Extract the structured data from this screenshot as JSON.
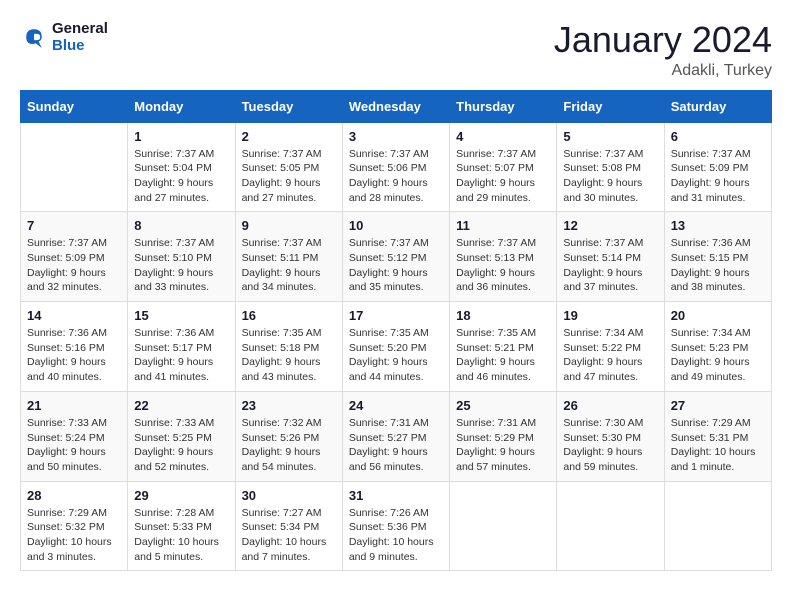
{
  "header": {
    "logo_line1": "General",
    "logo_line2": "Blue",
    "month_year": "January 2024",
    "location": "Adakli, Turkey"
  },
  "weekdays": [
    "Sunday",
    "Monday",
    "Tuesday",
    "Wednesday",
    "Thursday",
    "Friday",
    "Saturday"
  ],
  "weeks": [
    [
      {
        "day": "",
        "sunrise": "",
        "sunset": "",
        "daylight": ""
      },
      {
        "day": "1",
        "sunrise": "Sunrise: 7:37 AM",
        "sunset": "Sunset: 5:04 PM",
        "daylight": "Daylight: 9 hours and 27 minutes."
      },
      {
        "day": "2",
        "sunrise": "Sunrise: 7:37 AM",
        "sunset": "Sunset: 5:05 PM",
        "daylight": "Daylight: 9 hours and 27 minutes."
      },
      {
        "day": "3",
        "sunrise": "Sunrise: 7:37 AM",
        "sunset": "Sunset: 5:06 PM",
        "daylight": "Daylight: 9 hours and 28 minutes."
      },
      {
        "day": "4",
        "sunrise": "Sunrise: 7:37 AM",
        "sunset": "Sunset: 5:07 PM",
        "daylight": "Daylight: 9 hours and 29 minutes."
      },
      {
        "day": "5",
        "sunrise": "Sunrise: 7:37 AM",
        "sunset": "Sunset: 5:08 PM",
        "daylight": "Daylight: 9 hours and 30 minutes."
      },
      {
        "day": "6",
        "sunrise": "Sunrise: 7:37 AM",
        "sunset": "Sunset: 5:09 PM",
        "daylight": "Daylight: 9 hours and 31 minutes."
      }
    ],
    [
      {
        "day": "7",
        "sunrise": "Sunrise: 7:37 AM",
        "sunset": "Sunset: 5:09 PM",
        "daylight": "Daylight: 9 hours and 32 minutes."
      },
      {
        "day": "8",
        "sunrise": "Sunrise: 7:37 AM",
        "sunset": "Sunset: 5:10 PM",
        "daylight": "Daylight: 9 hours and 33 minutes."
      },
      {
        "day": "9",
        "sunrise": "Sunrise: 7:37 AM",
        "sunset": "Sunset: 5:11 PM",
        "daylight": "Daylight: 9 hours and 34 minutes."
      },
      {
        "day": "10",
        "sunrise": "Sunrise: 7:37 AM",
        "sunset": "Sunset: 5:12 PM",
        "daylight": "Daylight: 9 hours and 35 minutes."
      },
      {
        "day": "11",
        "sunrise": "Sunrise: 7:37 AM",
        "sunset": "Sunset: 5:13 PM",
        "daylight": "Daylight: 9 hours and 36 minutes."
      },
      {
        "day": "12",
        "sunrise": "Sunrise: 7:37 AM",
        "sunset": "Sunset: 5:14 PM",
        "daylight": "Daylight: 9 hours and 37 minutes."
      },
      {
        "day": "13",
        "sunrise": "Sunrise: 7:36 AM",
        "sunset": "Sunset: 5:15 PM",
        "daylight": "Daylight: 9 hours and 38 minutes."
      }
    ],
    [
      {
        "day": "14",
        "sunrise": "Sunrise: 7:36 AM",
        "sunset": "Sunset: 5:16 PM",
        "daylight": "Daylight: 9 hours and 40 minutes."
      },
      {
        "day": "15",
        "sunrise": "Sunrise: 7:36 AM",
        "sunset": "Sunset: 5:17 PM",
        "daylight": "Daylight: 9 hours and 41 minutes."
      },
      {
        "day": "16",
        "sunrise": "Sunrise: 7:35 AM",
        "sunset": "Sunset: 5:18 PM",
        "daylight": "Daylight: 9 hours and 43 minutes."
      },
      {
        "day": "17",
        "sunrise": "Sunrise: 7:35 AM",
        "sunset": "Sunset: 5:20 PM",
        "daylight": "Daylight: 9 hours and 44 minutes."
      },
      {
        "day": "18",
        "sunrise": "Sunrise: 7:35 AM",
        "sunset": "Sunset: 5:21 PM",
        "daylight": "Daylight: 9 hours and 46 minutes."
      },
      {
        "day": "19",
        "sunrise": "Sunrise: 7:34 AM",
        "sunset": "Sunset: 5:22 PM",
        "daylight": "Daylight: 9 hours and 47 minutes."
      },
      {
        "day": "20",
        "sunrise": "Sunrise: 7:34 AM",
        "sunset": "Sunset: 5:23 PM",
        "daylight": "Daylight: 9 hours and 49 minutes."
      }
    ],
    [
      {
        "day": "21",
        "sunrise": "Sunrise: 7:33 AM",
        "sunset": "Sunset: 5:24 PM",
        "daylight": "Daylight: 9 hours and 50 minutes."
      },
      {
        "day": "22",
        "sunrise": "Sunrise: 7:33 AM",
        "sunset": "Sunset: 5:25 PM",
        "daylight": "Daylight: 9 hours and 52 minutes."
      },
      {
        "day": "23",
        "sunrise": "Sunrise: 7:32 AM",
        "sunset": "Sunset: 5:26 PM",
        "daylight": "Daylight: 9 hours and 54 minutes."
      },
      {
        "day": "24",
        "sunrise": "Sunrise: 7:31 AM",
        "sunset": "Sunset: 5:27 PM",
        "daylight": "Daylight: 9 hours and 56 minutes."
      },
      {
        "day": "25",
        "sunrise": "Sunrise: 7:31 AM",
        "sunset": "Sunset: 5:29 PM",
        "daylight": "Daylight: 9 hours and 57 minutes."
      },
      {
        "day": "26",
        "sunrise": "Sunrise: 7:30 AM",
        "sunset": "Sunset: 5:30 PM",
        "daylight": "Daylight: 9 hours and 59 minutes."
      },
      {
        "day": "27",
        "sunrise": "Sunrise: 7:29 AM",
        "sunset": "Sunset: 5:31 PM",
        "daylight": "Daylight: 10 hours and 1 minute."
      }
    ],
    [
      {
        "day": "28",
        "sunrise": "Sunrise: 7:29 AM",
        "sunset": "Sunset: 5:32 PM",
        "daylight": "Daylight: 10 hours and 3 minutes."
      },
      {
        "day": "29",
        "sunrise": "Sunrise: 7:28 AM",
        "sunset": "Sunset: 5:33 PM",
        "daylight": "Daylight: 10 hours and 5 minutes."
      },
      {
        "day": "30",
        "sunrise": "Sunrise: 7:27 AM",
        "sunset": "Sunset: 5:34 PM",
        "daylight": "Daylight: 10 hours and 7 minutes."
      },
      {
        "day": "31",
        "sunrise": "Sunrise: 7:26 AM",
        "sunset": "Sunset: 5:36 PM",
        "daylight": "Daylight: 10 hours and 9 minutes."
      },
      {
        "day": "",
        "sunrise": "",
        "sunset": "",
        "daylight": ""
      },
      {
        "day": "",
        "sunrise": "",
        "sunset": "",
        "daylight": ""
      },
      {
        "day": "",
        "sunrise": "",
        "sunset": "",
        "daylight": ""
      }
    ]
  ]
}
